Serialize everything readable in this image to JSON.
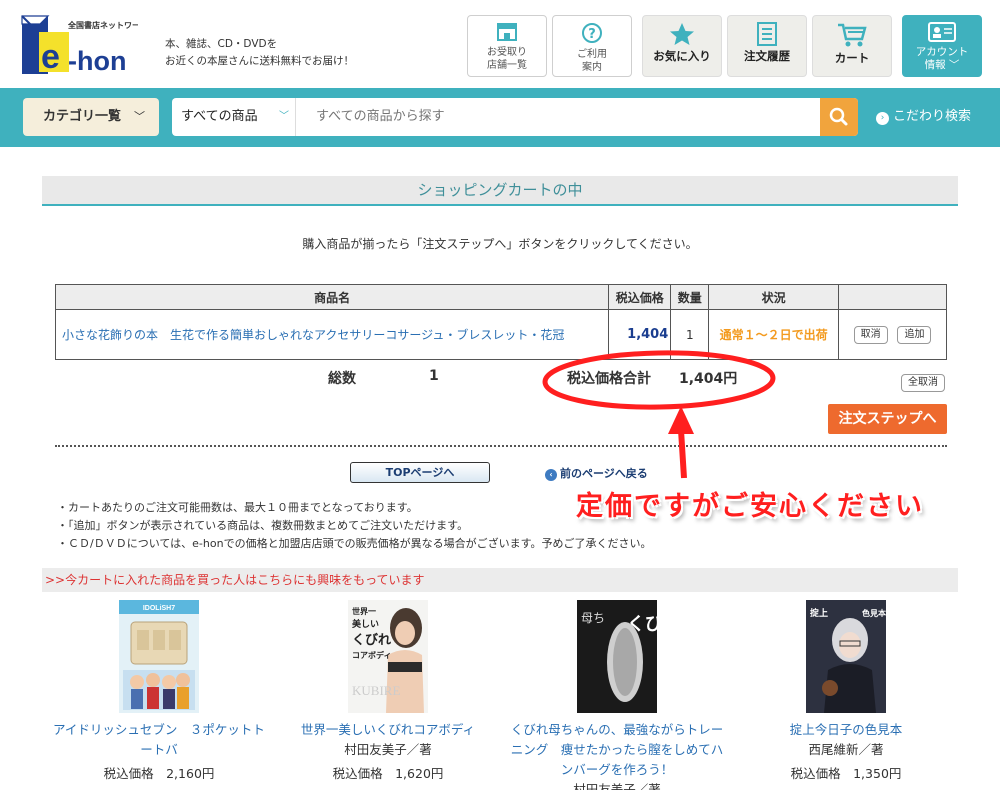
{
  "header": {
    "logo_top": "全国書店ネットワーク",
    "logo_main": "e-hon",
    "tagline_line1": "本、雑誌、CD・DVDを",
    "tagline_line2": "お近くの本屋さんに送料無料でお届け！",
    "btn_store_1": "お受取り",
    "btn_store_2": "店舗一覧",
    "btn_guide_1": "ご利用",
    "btn_guide_2": "案内",
    "btn_favorites": "お気に入り",
    "btn_history": "注文履歴",
    "btn_cart": "カート",
    "btn_account_1": "アカウント",
    "btn_account_2": "情報"
  },
  "search": {
    "category_button": "カテゴリ一覧",
    "scope_selected": "すべての商品",
    "placeholder": "すべての商品から探す",
    "advanced": "こだわり検索"
  },
  "cart": {
    "title": "ショッピングカートの中",
    "instruction": "購入商品が揃ったら「注文ステップへ」ボタンをクリックしてください。",
    "columns": [
      "商品名",
      "税込価格",
      "数量",
      "状況",
      ""
    ],
    "items": [
      {
        "name": "小さな花飾りの本　生花で作る簡単おしゃれなアクセサリーコサージュ・ブレスレット・花冠",
        "price": "1,404",
        "qty": "1",
        "status": "通常１～２日で出荷",
        "cancel": "取消",
        "add": "追加"
      }
    ],
    "total_count_label": "総数",
    "total_count": "1",
    "total_price_label": "税込価格合計",
    "total_price": "1,404円",
    "cancel_all": "全取消",
    "order_step": "注文ステップへ",
    "top_page": "TOPページへ",
    "back": "前のページへ戻る",
    "notes": [
      "・カートあたりのご注文可能冊数は、最大１０冊までとなっております。",
      "・「追加」ボタンが表示されている商品は、複数冊数まとめてご注文いただけます。",
      "・ＣＤ/ＤＶＤについては、e-honでの価格と加盟店店頭での販売価格が異なる場合がございます。予めご了承ください。"
    ]
  },
  "annotation": {
    "text": "定価ですがご安心ください"
  },
  "recommend": {
    "heading": ">>今カートに入れた商品を買った人はこちらにも興味をもっています",
    "price_label": "税込価格",
    "items": [
      {
        "title": "アイドリッシュセブン　３ポケットトートバ",
        "author": "",
        "price": "2,160円",
        "cover_label": "IDOLiSH7"
      },
      {
        "title": "世界一美しいくびれコアボディ",
        "author": "村田友美子／著",
        "price": "1,620円",
        "cover_label": "くびれ"
      },
      {
        "title": "くびれ母ちゃんの、最強ながらトレーニング　痩せたかったら膣をしめてハンバーグを作ろう！",
        "author": "村田友美子／著",
        "price": "",
        "cover_label": "くびれ"
      },
      {
        "title": "掟上今日子の色見本",
        "author": "西尾維新／著",
        "price": "1,350円",
        "cover_label": "色見本"
      }
    ]
  },
  "colors": {
    "teal": "#3fb1be",
    "orange": "#ee6a2e",
    "search_go": "#f1a43d",
    "annotation_red": "#ff1f1f",
    "status_orange": "#f39a1e"
  }
}
